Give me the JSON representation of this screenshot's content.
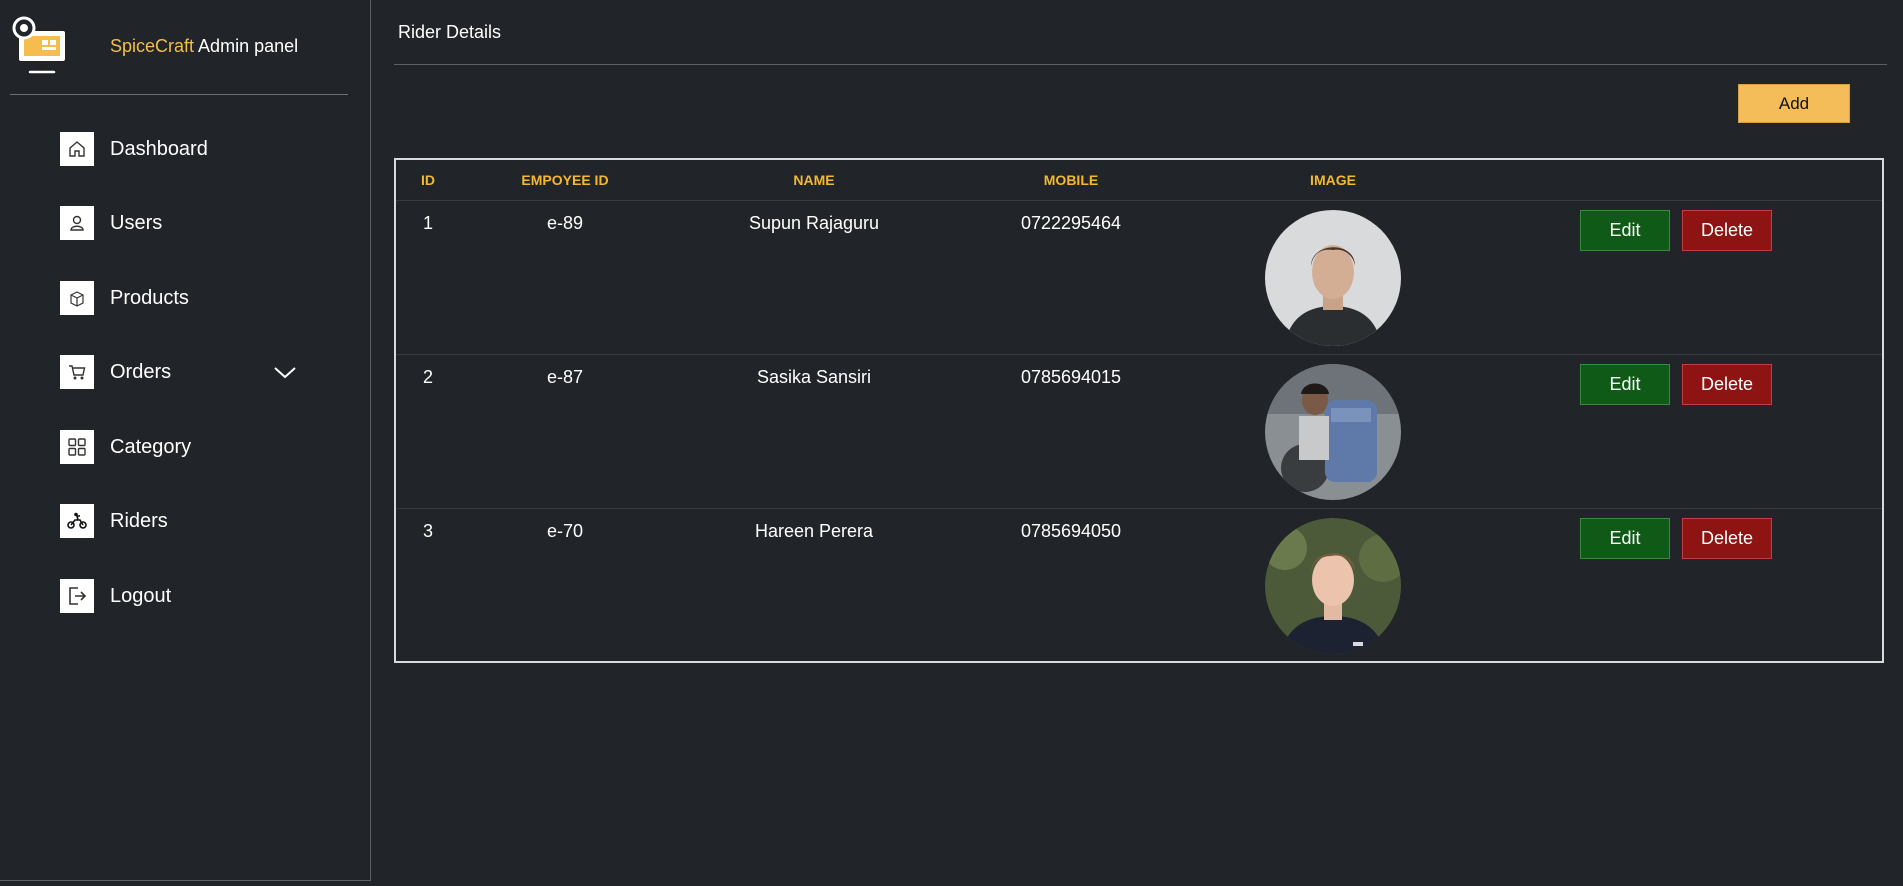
{
  "brand": {
    "name_accent": "SpiceCraft",
    "name_rest": " Admin panel",
    "logo_icon": "monitor-gear-logo-icon"
  },
  "sidebar": {
    "items": [
      {
        "label": "Dashboard",
        "icon": "home-icon"
      },
      {
        "label": "Users",
        "icon": "user-icon"
      },
      {
        "label": "Products",
        "icon": "box-icon"
      },
      {
        "label": " Orders",
        "icon": "cart-icon",
        "has_chevron": true
      },
      {
        "label": "Category",
        "icon": "grid-icon"
      },
      {
        "label": "Riders",
        "icon": "motorbike-icon"
      },
      {
        "label": "Logout",
        "icon": "logout-icon"
      }
    ]
  },
  "main": {
    "title": "Rider Details",
    "add_label": "Add",
    "columns": [
      "ID",
      "EMPOYEE ID",
      "NAME",
      "MOBILE",
      "IMAGE"
    ],
    "rows": [
      {
        "id": "1",
        "employee_id": "e-89",
        "name": "Supun Rajaguru",
        "mobile": "0722295464",
        "edit": "Edit",
        "delete": "Delete"
      },
      {
        "id": "2",
        "employee_id": "e-87",
        "name": "Sasika Sansiri",
        "mobile": "0785694015",
        "edit": "Edit",
        "delete": "Delete"
      },
      {
        "id": "3",
        "employee_id": "e-70",
        "name": "Hareen Perera",
        "mobile": "0785694050",
        "edit": "Edit",
        "delete": "Delete"
      }
    ]
  },
  "colors": {
    "background": "#212429",
    "accent": "#f5bd50",
    "header_text": "#f5b82e",
    "edit": "#0f5a17",
    "delete": "#8e1414"
  }
}
